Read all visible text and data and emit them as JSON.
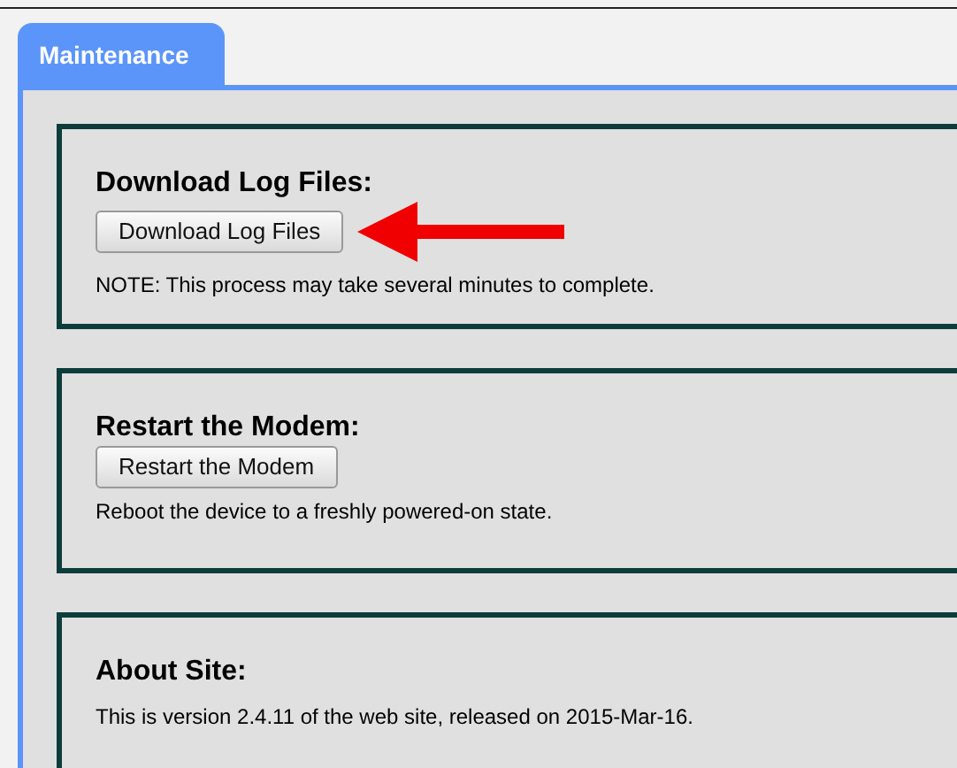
{
  "tabs": [
    {
      "label": "Maintenance",
      "selected": true
    }
  ],
  "sections": [
    {
      "title": "Download Log Files:",
      "button": "Download Log Files",
      "arrow": true,
      "note": "NOTE: This process may take several minutes to complete."
    },
    {
      "title": "Restart the Modem:",
      "button": "Restart the Modem",
      "arrow": false,
      "note": "Reboot the device to a freshly powered-on state."
    },
    {
      "title": "About Site:",
      "arrow": false,
      "note": "This is version 2.4.11 of the web site, released on 2015-Mar-16."
    }
  ]
}
